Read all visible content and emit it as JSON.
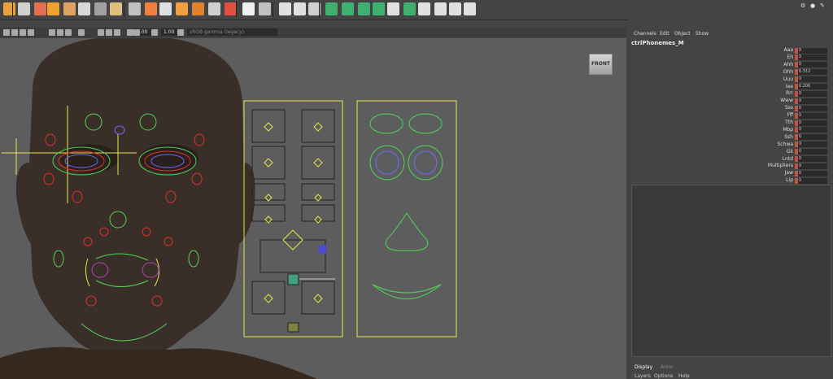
{
  "toolbar": {
    "icons": [
      "script-icon",
      "select-icon",
      "bevel-icon",
      "extrude-icon",
      "bridge-icon",
      "fill-hole-icon",
      "merge-icon",
      "split-icon",
      "wedge-icon",
      "append-icon",
      "poke-icon",
      "cube-icon",
      "combine-icon",
      "separate-icon",
      "smooth-icon",
      "reduce-icon",
      "mirror-icon",
      "cut-icon",
      "target-weld-icon",
      "multicut-icon",
      "edge-loop-icon",
      "connect-icon",
      "uv-icon",
      "unfold-icon",
      "layout-icon",
      "cut-sew-icon",
      "planar-icon",
      "camera-icon",
      "automatic-icon",
      "stitch-icon"
    ]
  },
  "viewbar": {
    "field1": "0.00",
    "field2": "1.00",
    "camera_field": "sRGB gamma (legacy)"
  },
  "viewport": {
    "camera_label": "FRONT"
  },
  "sidebar": {
    "tabs": [
      "Channels",
      "Edit",
      "Object",
      "Show"
    ],
    "object_name": "ctrlPhonemes_M",
    "channels": [
      {
        "label": "Aaa",
        "value": "0"
      },
      {
        "label": "Eh",
        "value": "0"
      },
      {
        "label": "Ahh",
        "value": "0"
      },
      {
        "label": "Ohh",
        "value": "0.312"
      },
      {
        "label": "Uuu",
        "value": "0"
      },
      {
        "label": "Iee",
        "value": "0.206"
      },
      {
        "label": "Rrr",
        "value": "0"
      },
      {
        "label": "Www",
        "value": "0"
      },
      {
        "label": "Sss",
        "value": "0"
      },
      {
        "label": "Fff",
        "value": "0"
      },
      {
        "label": "Tth",
        "value": "0"
      },
      {
        "label": "Mbp",
        "value": "0"
      },
      {
        "label": "Ssh",
        "value": "0"
      },
      {
        "label": "Schwa",
        "value": "0"
      },
      {
        "label": "Gk",
        "value": "0"
      },
      {
        "label": "Lntd",
        "value": "0"
      },
      {
        "label": "Multipliers",
        "value": "0"
      },
      {
        "label": "Jaw",
        "value": "0"
      },
      {
        "label": "Lip",
        "value": "0"
      }
    ],
    "bottom_tabs": [
      "Display",
      "Anim"
    ],
    "bottom_menu": [
      "Layers",
      "Options",
      "Help"
    ]
  },
  "colors": {
    "viewport_bg": "#5d5d5d",
    "ctrl_yellow": "#e6e64a",
    "ctrl_green": "#4fd65a",
    "ctrl_red": "#e03030",
    "ctrl_blue": "#6a6aff",
    "keyed_red": "#c8504b"
  }
}
